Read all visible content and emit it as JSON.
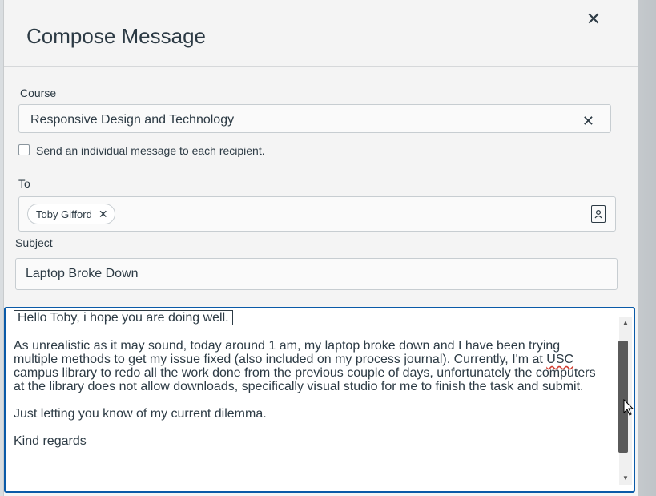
{
  "dialog": {
    "title": "Compose Message",
    "close_icon": "close-icon"
  },
  "course": {
    "label": "Course",
    "value": "Responsive Design and Technology",
    "clear_icon": "close-icon"
  },
  "individual_message": {
    "label": "Send an individual message to each recipient.",
    "checked": false
  },
  "to": {
    "label": "To",
    "recipients": [
      {
        "name": "Toby Gifford",
        "remove_icon": "close-icon"
      }
    ],
    "address_book_icon": "address-book-icon"
  },
  "subject": {
    "label": "Subject",
    "value": "Laptop Broke Down"
  },
  "message": {
    "greeting": "Hello Toby, i hope you are doing well.",
    "paragraph1_part1": "As unrealistic as it may sound, today around 1 am, my laptop broke down and I have been trying multiple methods to get my issue fixed (also included on my process journal). Currently, I'm at ",
    "paragraph1_misspelled": "USC",
    "paragraph1_part2": " campus library to redo all the work done from the previous couple of days, unfortunately the computers at the library does not allow downloads, specifically visual studio for me to finish the task and submit.",
    "paragraph2": "Just letting you know of my current dilemma.",
    "closing": "Kind regards"
  },
  "scrollbar": {
    "up_icon": "triangle-up-icon",
    "down_icon": "triangle-down-icon"
  }
}
